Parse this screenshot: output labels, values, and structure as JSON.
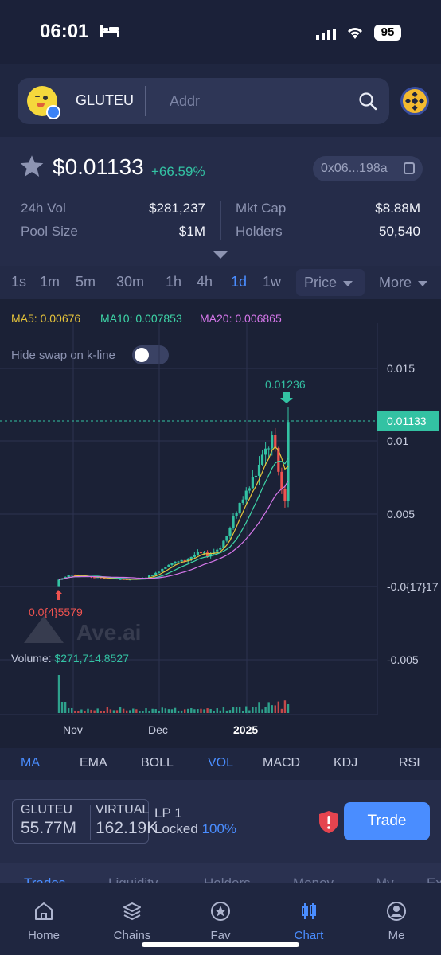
{
  "status": {
    "time": "06:01",
    "battery": "95"
  },
  "search": {
    "token_name": "GLUTEU",
    "placeholder": "Addr"
  },
  "price": {
    "value": "$0.01133",
    "change": "+66.59%",
    "address": "0x06...198a",
    "stats": {
      "vol_label": "24h Vol",
      "vol_value": "$281,237",
      "mcap_label": "Mkt Cap",
      "mcap_value": "$8.88M",
      "pool_label": "Pool Size",
      "pool_value": "$1M",
      "holders_label": "Holders",
      "holders_value": "50,540"
    }
  },
  "timeframes": {
    "items": [
      "1s",
      "1m",
      "5m",
      "30m",
      "1h",
      "4h",
      "1d",
      "1w"
    ],
    "active": "1d",
    "price_label": "Price",
    "more_label": "More"
  },
  "ma": {
    "ma5": "MA5: 0.00676",
    "ma10": "MA10: 0.007853",
    "ma20": "MA20: 0.006865",
    "ma5_color": "#e5c33a",
    "ma10_color": "#3ed6a8",
    "ma20_color": "#d577ea"
  },
  "chart_controls": {
    "hide_swap_label": "Hide swap on k-line",
    "hide_swap_on": false,
    "watermark": "Ave.ai"
  },
  "chart_data": {
    "type": "candlestick",
    "y_ticks": [
      "0.015",
      "0.01",
      "0.005",
      "-0.0{17}17",
      "-0.005"
    ],
    "x_ticks": [
      "Nov",
      "Dec",
      "2025"
    ],
    "ylim": [
      -0.0075,
      0.0175
    ],
    "current_price_label": "0.01133",
    "current_price": 0.01133,
    "high_label": "0.01236",
    "high": 0.01236,
    "low_label": "0.0{4}5579",
    "low": 5.579e-05,
    "volume_label": "Volume: ",
    "volume_value": "$271,714.8527",
    "trend_points": [
      [
        0,
        0.0005
      ],
      [
        0.05,
        0.00088
      ],
      [
        0.12,
        0.0007
      ],
      [
        0.2,
        0.0006
      ],
      [
        0.28,
        0.0005
      ],
      [
        0.36,
        0.00055
      ],
      [
        0.42,
        0.0009
      ],
      [
        0.48,
        0.0016
      ],
      [
        0.55,
        0.0018
      ],
      [
        0.6,
        0.0023
      ],
      [
        0.65,
        0.0022
      ],
      [
        0.7,
        0.0027
      ],
      [
        0.74,
        0.0037
      ],
      [
        0.78,
        0.0055
      ],
      [
        0.82,
        0.0065
      ],
      [
        0.86,
        0.0078
      ],
      [
        0.9,
        0.0092
      ],
      [
        0.93,
        0.0102
      ],
      [
        0.95,
        0.0085
      ],
      [
        0.97,
        0.0068
      ],
      [
        0.985,
        0.0058
      ],
      [
        1.0,
        0.01133
      ]
    ],
    "colors": {
      "up": "#33c2a3",
      "down": "#ef5350"
    }
  },
  "indicators": {
    "items": [
      "MA",
      "EMA",
      "BOLL",
      "VOL",
      "MACD",
      "KDJ",
      "RSI"
    ],
    "active": [
      "MA",
      "VOL"
    ]
  },
  "pair": {
    "base_symbol": "GLUTEU",
    "base_amount": "55.77M",
    "quote_symbol": "VIRTUAL",
    "quote_amount": "162.19K",
    "lp_label": "LP 1",
    "locked_label": "Locked",
    "locked_pct": "100%",
    "trade_label": "Trade"
  },
  "bottom_tabs": [
    "Trades",
    "Liquidity",
    "Holders",
    "Money",
    "My",
    "Ex"
  ],
  "nav": [
    {
      "label": "Home",
      "icon": "home-icon"
    },
    {
      "label": "Chains",
      "icon": "layers-icon"
    },
    {
      "label": "Fav",
      "icon": "star-icon"
    },
    {
      "label": "Chart",
      "icon": "candle-icon"
    },
    {
      "label": "Me",
      "icon": "user-icon"
    }
  ],
  "nav_active": "Chart"
}
